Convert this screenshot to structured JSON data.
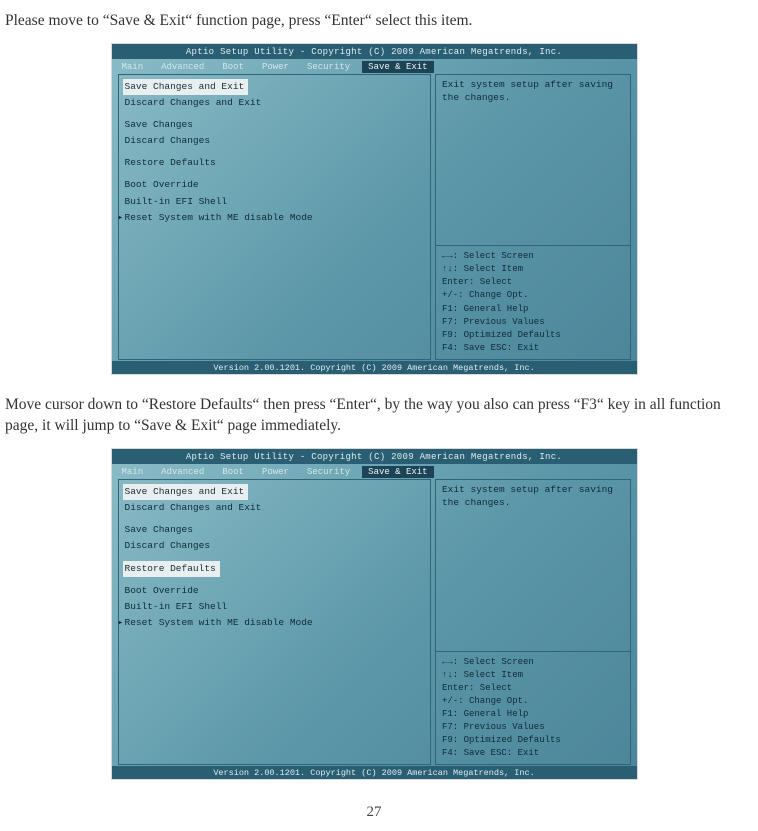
{
  "instr1": "Please move to “Save & Exit“ function page, press “Enter“ select this item.",
  "instr2": "Move cursor down to “Restore Defaults“ then press “Enter“, by the way you also can press “F3“ key in all function page, it will jump to “Save & Exit“ page immediately.",
  "page_number": "27",
  "bios": {
    "title": "Aptio Setup Utility - Copyright (C) 2009 American Megatrends, Inc.",
    "tabs": [
      "Main",
      "Advanced",
      "Boot",
      "Power",
      "Security",
      "Save & Exit"
    ],
    "menu": {
      "save_changes_exit": "Save Changes and Exit",
      "discard_changes_exit": "Discard Changes and Exit",
      "save_changes": "Save Changes",
      "discard_changes": "Discard Changes",
      "restore_defaults": "Restore Defaults",
      "boot_override": "Boot Override",
      "efi_shell": "Built-in EFI Shell",
      "reset_me": "Reset System with ME disable Mode"
    },
    "desc": "Exit system setup after saving the changes.",
    "keys1": [
      "←→: Select Screen",
      "↑↓: Select Item",
      "Enter: Select",
      "+/-: Change Opt.",
      "F1: General Help",
      "F7: Previous Values",
      "F9: Optimized Defaults",
      "F4: Save  ESC: Exit"
    ],
    "keys2": [
      "←→: Select Screen",
      "↑↓: Select Item",
      "Enter: Select",
      "+/-: Change Opt.",
      "F1: General Help",
      "F7: Previous Values",
      "F9: Optimized Defaults",
      "F4: Save  ESC: Exit"
    ],
    "footer": "Version 2.00.1201. Copyright (C) 2009 American Megatrends, Inc."
  }
}
